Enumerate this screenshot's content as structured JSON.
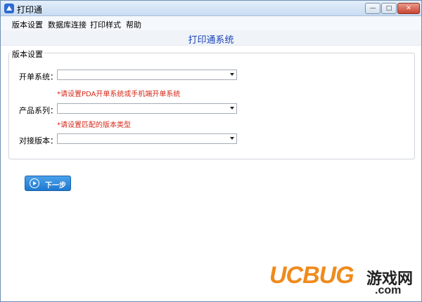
{
  "window": {
    "title": "打印通"
  },
  "menu": [
    "版本设置",
    "数据库连接",
    "打印样式",
    "帮助"
  ],
  "header": {
    "system_title": "打印通系统"
  },
  "group": {
    "legend": "版本设置",
    "fields": [
      {
        "label": "开单系统：",
        "value": "",
        "hint": "*请设置PDA开单系统或手机端开单系统"
      },
      {
        "label": "产品系列：",
        "value": "",
        "hint": "*请设置匹配的版本类型"
      },
      {
        "label": "对接版本：",
        "value": "",
        "hint": ""
      }
    ]
  },
  "buttons": {
    "next": "下一步"
  },
  "watermark": {
    "logo": "UCBUG",
    "cn": "游戏网",
    "domain": ".com"
  },
  "colors": {
    "accent": "#1a44b8",
    "hint": "#d42a1a",
    "button": "#1f78cf",
    "watermark": "#f08a1c"
  }
}
